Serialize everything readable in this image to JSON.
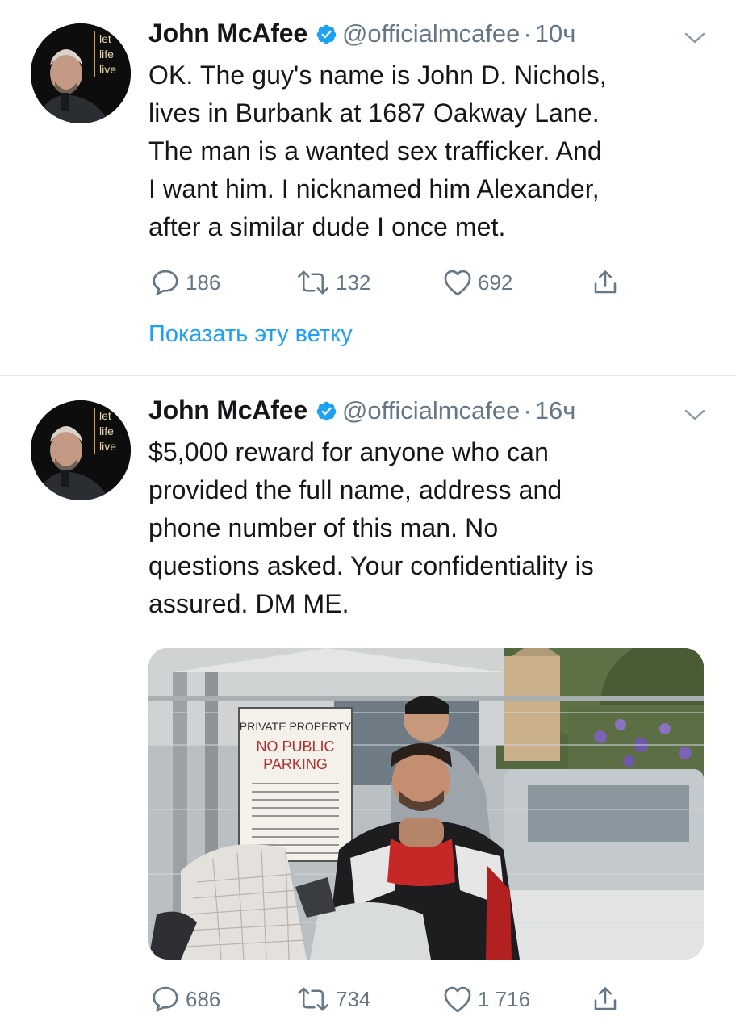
{
  "colors": {
    "link": "#1da1f2",
    "secondary": "#657786",
    "text": "#14171a",
    "divider": "#e1e8ed"
  },
  "avatar_words": [
    "let",
    "life",
    "live"
  ],
  "tweets": [
    {
      "author": "John McAfee",
      "handle": "@officialmcafee",
      "dot": "·",
      "time": "10ч",
      "lines": [
        "OK. The guy's name is John D. Nichols,",
        "lives in Burbank at 1687 Oakway Lane.",
        "The man is a wanted sex trafficker. And",
        "I want him. I nicknamed him Alexander,",
        "after a similar dude I once met."
      ],
      "replies": "186",
      "retweets": "132",
      "likes": "692",
      "thread_link": "Показать эту ветку"
    },
    {
      "author": "John McAfee",
      "handle": "@officialmcafee",
      "dot": "·",
      "time": "16ч",
      "lines": [
        "$5,000 reward for anyone who can",
        "provided the full name, address and",
        "phone number of this man. No",
        "questions asked. Your confidentiality is",
        "assured. DM ME."
      ],
      "media_sign": {
        "line1": "PRIVATE PROPERTY",
        "line2": "NO PUBLIC",
        "line3": "PARKING"
      },
      "replies": "686",
      "retweets": "734",
      "likes": "1 716"
    }
  ]
}
